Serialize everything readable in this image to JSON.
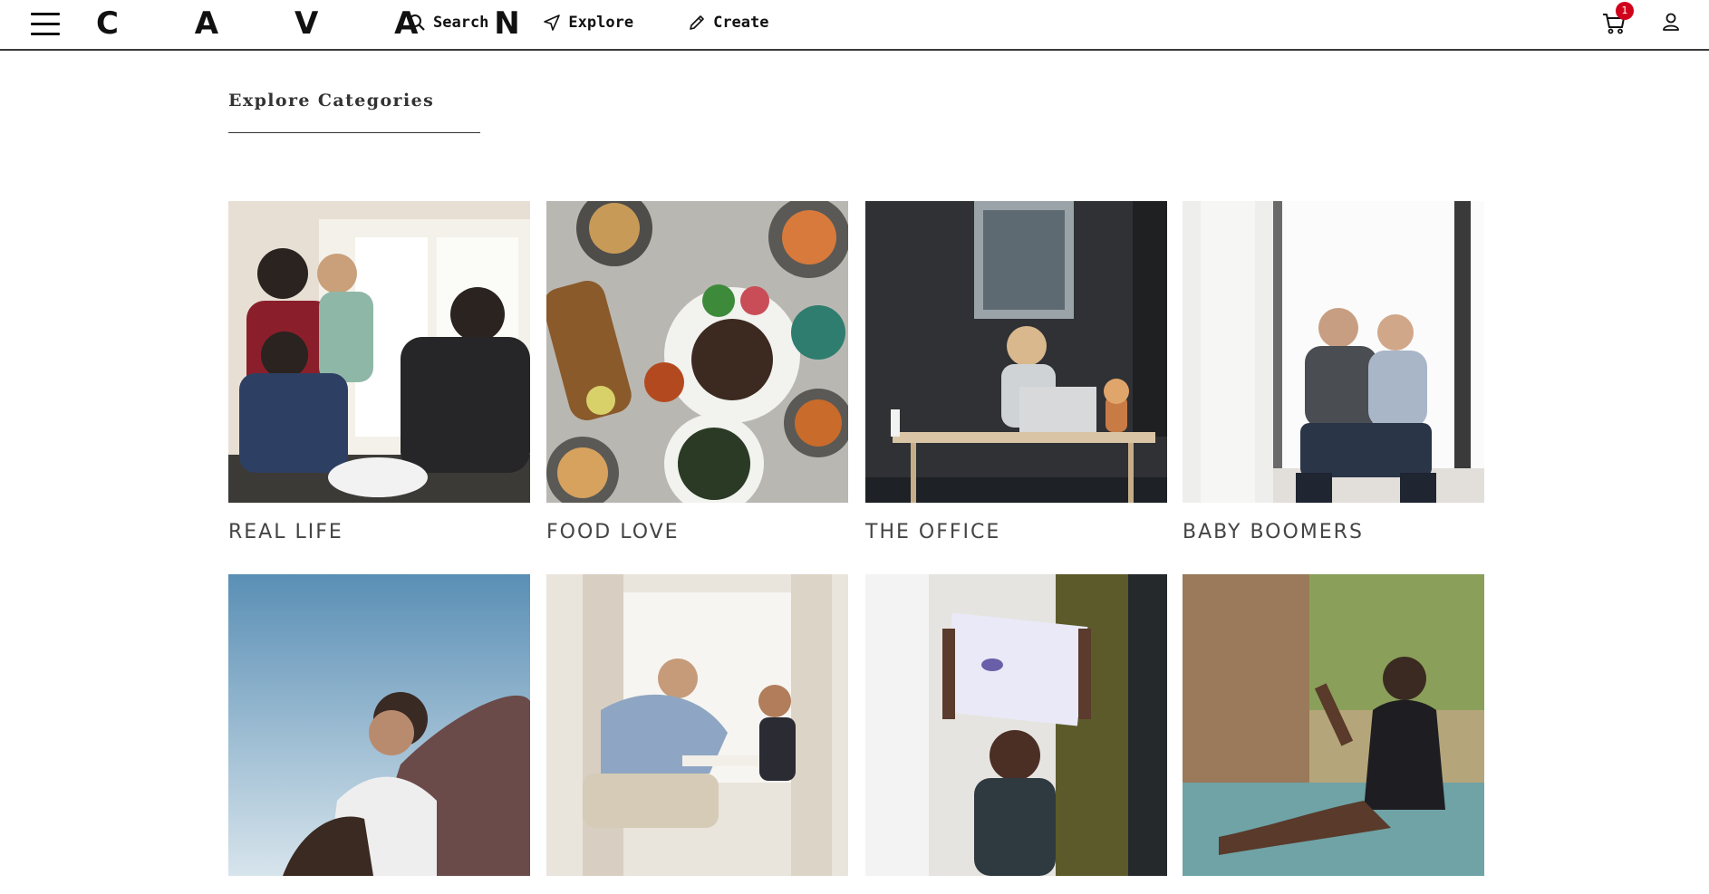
{
  "header": {
    "logo": "C A V A N",
    "nav": [
      {
        "label": "Search",
        "icon": "search-icon"
      },
      {
        "label": "Explore",
        "icon": "navigation-arrow-icon"
      },
      {
        "label": "Create",
        "icon": "pencil-icon"
      }
    ],
    "cart_count": "1"
  },
  "main": {
    "title": "Explore Categories",
    "categories": [
      {
        "label": "REAL LIFE"
      },
      {
        "label": "FOOD LOVE"
      },
      {
        "label": "THE OFFICE"
      },
      {
        "label": "BABY BOOMERS"
      },
      {
        "label": ""
      },
      {
        "label": ""
      },
      {
        "label": ""
      },
      {
        "label": ""
      }
    ]
  },
  "colors": {
    "badge": "#d0021b",
    "text": "#222222",
    "divider": "#3a3a3a"
  }
}
